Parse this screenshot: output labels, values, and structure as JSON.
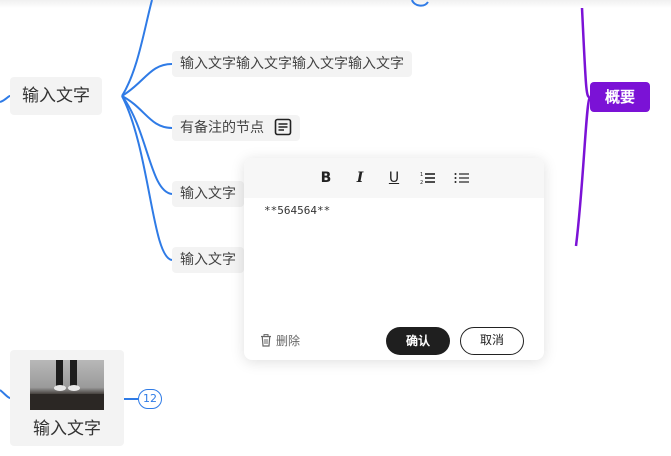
{
  "mindmap": {
    "main_node_label": "输入文字",
    "children": [
      {
        "label": "输入文字输入文字输入文字输入文字"
      },
      {
        "label": "有备注的节点",
        "has_note": true
      },
      {
        "label": "输入文字"
      },
      {
        "label": "输入文字"
      }
    ],
    "summary_label": "概要",
    "image_node_label": "输入文字",
    "collapse_badge": "12",
    "link_color": "#2f7be6",
    "summary_color": "#7b12d6"
  },
  "note_editor": {
    "toolbar": {
      "bold": "B",
      "italic": "I",
      "underline": "U",
      "ordered_list": "ordered-list-icon",
      "bullet_list": "bullet-list-icon"
    },
    "content": "**564564**",
    "delete_label": "删除",
    "confirm_label": "确认",
    "cancel_label": "取消"
  }
}
